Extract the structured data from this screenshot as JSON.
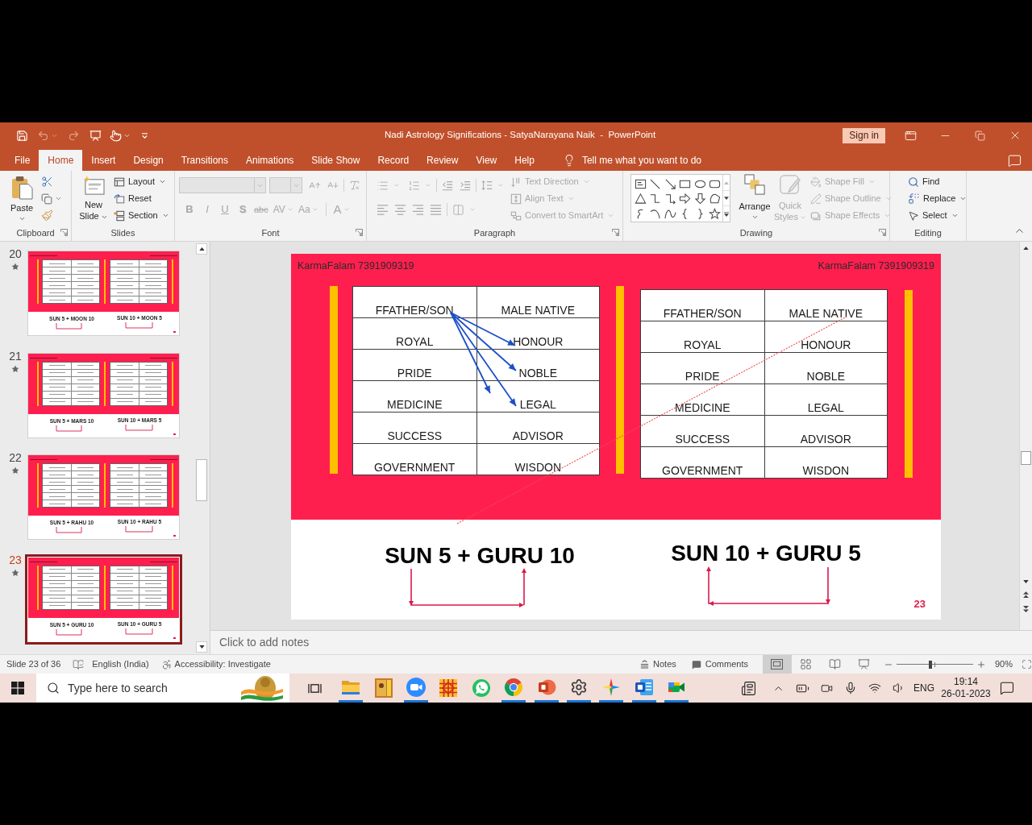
{
  "window": {
    "title": "Nadi Astrology Significations - SatyaNarayana Naik  -  PowerPoint",
    "sign_in": "Sign in"
  },
  "quick_access": [
    {
      "kind": "save",
      "disabled": false,
      "dropdown": false
    },
    {
      "kind": "undo",
      "disabled": true,
      "dropdown": true
    },
    {
      "kind": "redo",
      "disabled": true,
      "dropdown": false
    },
    {
      "kind": "present",
      "disabled": false,
      "dropdown": false
    },
    {
      "kind": "touch",
      "disabled": false,
      "dropdown": true
    }
  ],
  "tabs": [
    {
      "label": "File",
      "selected": false
    },
    {
      "label": "Home",
      "selected": true
    },
    {
      "label": "Insert",
      "selected": false
    },
    {
      "label": "Design",
      "selected": false
    },
    {
      "label": "Transitions",
      "selected": false
    },
    {
      "label": "Animations",
      "selected": false
    },
    {
      "label": "Slide Show",
      "selected": false
    },
    {
      "label": "Record",
      "selected": false
    },
    {
      "label": "Review",
      "selected": false
    },
    {
      "label": "View",
      "selected": false
    },
    {
      "label": "Help",
      "selected": false
    }
  ],
  "tell_me": {
    "placeholder": "Tell me what you want to do"
  },
  "ribbon": {
    "clipboard": {
      "label": "Clipboard",
      "paste": "Paste"
    },
    "slides": {
      "label": "Slides",
      "new_slide": "New Slide",
      "commands": [
        {
          "label": "Layout",
          "dropdown": true
        },
        {
          "label": "Reset",
          "dropdown": false
        },
        {
          "label": "Section",
          "dropdown": true
        }
      ]
    },
    "font": {
      "label": "Font",
      "disabled": true,
      "format_buttons": [
        "B",
        "I",
        "U",
        "S",
        "abc",
        "AV",
        "Aa",
        "A"
      ]
    },
    "paragraph": {
      "label": "Paragraph",
      "disabled": true,
      "commands": [
        {
          "label": "Text Direction",
          "disabled": true
        },
        {
          "label": "Align Text",
          "disabled": true
        },
        {
          "label": "Convert to SmartArt",
          "disabled": true
        }
      ]
    },
    "drawing": {
      "label": "Drawing",
      "arrange": "Arrange",
      "quick_styles": {
        "label": "Quick Styles",
        "disabled": true
      },
      "commands": [
        {
          "label": "Shape Fill",
          "disabled": true
        },
        {
          "label": "Shape Outline",
          "disabled": true
        },
        {
          "label": "Shape Effects",
          "disabled": true
        }
      ]
    },
    "editing": {
      "label": "Editing",
      "commands": [
        {
          "label": "Find",
          "dropdown": false
        },
        {
          "label": "Replace",
          "dropdown": true
        },
        {
          "label": "Select",
          "dropdown": true
        }
      ]
    }
  },
  "slides_panel": {
    "slides": [
      {
        "number": "20",
        "selected": false,
        "captions": [
          "SUN 5 + MOON 10",
          "SUN 10 + MOON 5"
        ]
      },
      {
        "number": "21",
        "selected": false,
        "captions": [
          "SUN 5 + MARS 10",
          "SUN 10 + MARS 5"
        ]
      },
      {
        "number": "22",
        "selected": false,
        "captions": [
          "SUN 5 + RAHU 10",
          "SUN 10 + RAHU 5"
        ]
      },
      {
        "number": "23",
        "selected": true,
        "captions": [
          "SUN 5 + GURU 10",
          "SUN 10 + GURU 5"
        ]
      }
    ]
  },
  "slide": {
    "header_left": "KarmaFalam 7391909319",
    "header_right": "KarmaFalam 7391909319",
    "tables": [
      {
        "rows": [
          [
            "FFATHER/SON",
            "MALE NATIVE"
          ],
          [
            "ROYAL",
            "HONOUR"
          ],
          [
            "PRIDE",
            "NOBLE"
          ],
          [
            "MEDICINE",
            "LEGAL"
          ],
          [
            "SUCCESS",
            "ADVISOR"
          ],
          [
            "GOVERNMENT",
            "WISDON"
          ]
        ]
      },
      {
        "rows": [
          [
            "FFATHER/SON",
            "MALE NATIVE"
          ],
          [
            "ROYAL",
            "HONOUR"
          ],
          [
            "PRIDE",
            "NOBLE"
          ],
          [
            "MEDICINE",
            "LEGAL"
          ],
          [
            "SUCCESS",
            "ADVISOR"
          ],
          [
            "GOVERNMENT",
            "WISDON"
          ]
        ]
      }
    ],
    "captions": [
      "SUN 5 + GURU 10",
      "SUN 10 + GURU 5"
    ],
    "page_number": "23"
  },
  "notes": {
    "placeholder": "Click to add notes"
  },
  "status_bar": {
    "slide": "Slide 23 of 36",
    "language": "English (India)",
    "accessibility": "Accessibility: Investigate",
    "notes": "Notes",
    "comments": "Comments",
    "views": [
      {
        "kind": "normal",
        "selected": true
      },
      {
        "kind": "sorter",
        "selected": false
      },
      {
        "kind": "reading",
        "selected": false
      },
      {
        "kind": "slideshow",
        "selected": false
      }
    ],
    "zoom": {
      "level": 0.44,
      "reading": "90%"
    }
  },
  "taskbar": {
    "search": {
      "placeholder": "Type here to search"
    },
    "apps": [
      {
        "kind": "folder",
        "running": true
      },
      {
        "kind": "picture",
        "running": false
      },
      {
        "kind": "video",
        "running": true
      },
      {
        "kind": "grid",
        "running": false
      },
      {
        "kind": "chat",
        "running": false
      },
      {
        "kind": "browser",
        "running": true
      },
      {
        "kind": "presentation",
        "running": true
      },
      {
        "kind": "settings",
        "running": true
      },
      {
        "kind": "star",
        "running": true
      },
      {
        "kind": "document",
        "running": true
      },
      {
        "kind": "meet",
        "running": true
      }
    ],
    "language": "ENG",
    "time": "19:14",
    "date": "26-01-2023"
  }
}
